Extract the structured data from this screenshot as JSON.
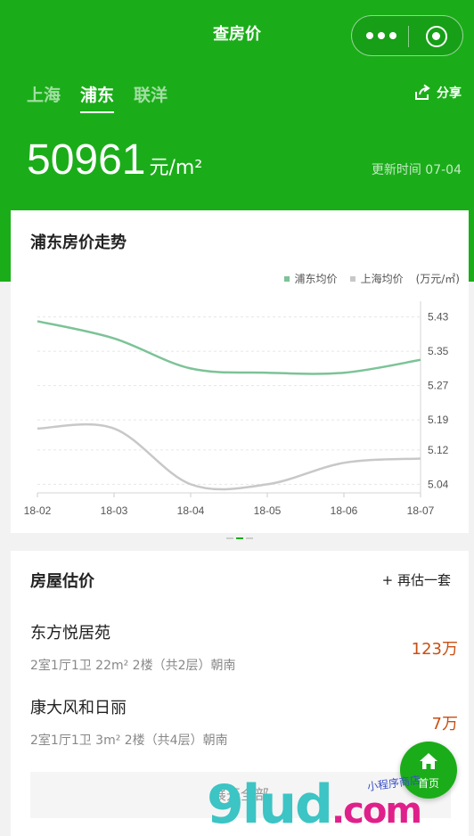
{
  "nav": {
    "title": "查房价"
  },
  "city_tabs": [
    {
      "label": "上海",
      "active": false
    },
    {
      "label": "浦东",
      "active": true
    },
    {
      "label": "联洋",
      "active": false
    }
  ],
  "share_label": "分享",
  "price": {
    "value": "50961",
    "unit": "元/m²"
  },
  "update_time": "更新时间 07-04",
  "trend": {
    "title": "浦东房价走势"
  },
  "chart_data": {
    "type": "line",
    "x": [
      "18-02",
      "18-03",
      "18-04",
      "18-05",
      "18-06",
      "18-07"
    ],
    "series": [
      {
        "name": "浦东均价",
        "color": "#7cc397",
        "values": [
          5.42,
          5.38,
          5.31,
          5.3,
          5.3,
          5.33
        ]
      },
      {
        "name": "上海均价",
        "color": "#c8c8c8",
        "values": [
          5.17,
          5.17,
          5.04,
          5.04,
          5.09,
          5.1
        ]
      }
    ],
    "y_ticks": [
      "5.43",
      "5.35",
      "5.27",
      "5.19",
      "5.12",
      "5.04"
    ],
    "ylim": [
      5.02,
      5.45
    ],
    "yunit": "(万元/㎡)",
    "y_axis_position": "right",
    "legend_position": "top-right",
    "grid": true
  },
  "estimate": {
    "title": "房屋估价",
    "again_label": "+ 再估一套",
    "houses": [
      {
        "name": "东方悦居苑",
        "detail": "2室1厅1卫 22m² 2楼（共2层）朝南",
        "value": "123万"
      },
      {
        "name": "康大风和日丽",
        "detail": "2室1厅1卫 3m² 2楼（共4层）朝南",
        "value": "7万"
      }
    ],
    "expand_label": "展开全部"
  },
  "home_button": {
    "label": "首页"
  },
  "watermark": {
    "text": "9lud",
    "suffix": ".com",
    "stamp": "小程序商店"
  }
}
